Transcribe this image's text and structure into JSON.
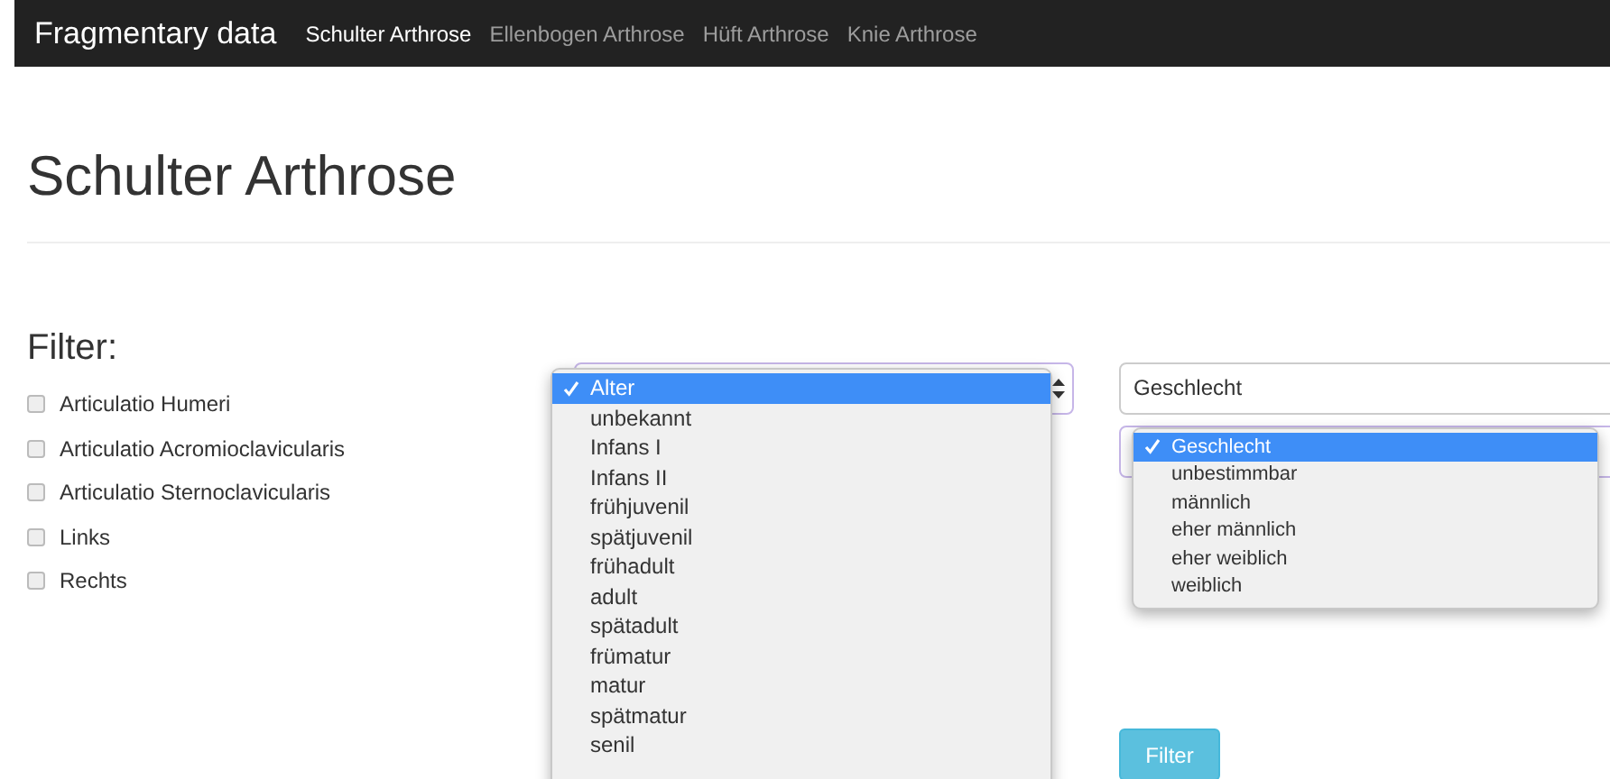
{
  "navbar": {
    "brand": "Fragmentary data",
    "links": [
      {
        "label": "Schulter Arthrose",
        "selected": true
      },
      {
        "label": "Ellenbogen Arthrose",
        "selected": false
      },
      {
        "label": "Hüft Arthrose",
        "selected": false
      },
      {
        "label": "Knie Arthrose",
        "selected": false
      }
    ]
  },
  "page_title": "Schulter Arthrose",
  "filter_heading": "Filter:",
  "checkboxes": [
    {
      "label": "Articulatio Humeri",
      "checked": false
    },
    {
      "label": "Articulatio Acromioclavicularis",
      "checked": false
    },
    {
      "label": "Articulatio Sternoclavicularis",
      "checked": false
    },
    {
      "label": "Links",
      "checked": false
    },
    {
      "label": "Rechts",
      "checked": false
    }
  ],
  "age_select": {
    "options": [
      {
        "label": "Alter",
        "selected": true
      },
      {
        "label": "unbekannt",
        "selected": false
      },
      {
        "label": "Infans I",
        "selected": false
      },
      {
        "label": "Infans II",
        "selected": false
      },
      {
        "label": "frühjuvenil",
        "selected": false
      },
      {
        "label": "spätjuvenil",
        "selected": false
      },
      {
        "label": "frühadult",
        "selected": false
      },
      {
        "label": "adult",
        "selected": false
      },
      {
        "label": "spätadult",
        "selected": false
      },
      {
        "label": "frümatur",
        "selected": false
      },
      {
        "label": "matur",
        "selected": false
      },
      {
        "label": "spätmatur",
        "selected": false
      },
      {
        "label": "senil",
        "selected": false
      }
    ]
  },
  "sex_select": {
    "value": "Geschlecht"
  },
  "sex_select_2": {
    "options": [
      {
        "label": "Geschlecht",
        "selected": true
      },
      {
        "label": "unbestimmbar",
        "selected": false
      },
      {
        "label": "männlich",
        "selected": false
      },
      {
        "label": "eher männlich",
        "selected": false
      },
      {
        "label": "eher weiblich",
        "selected": false
      },
      {
        "label": "weiblich",
        "selected": false
      }
    ]
  },
  "filter_button": "Filter"
}
